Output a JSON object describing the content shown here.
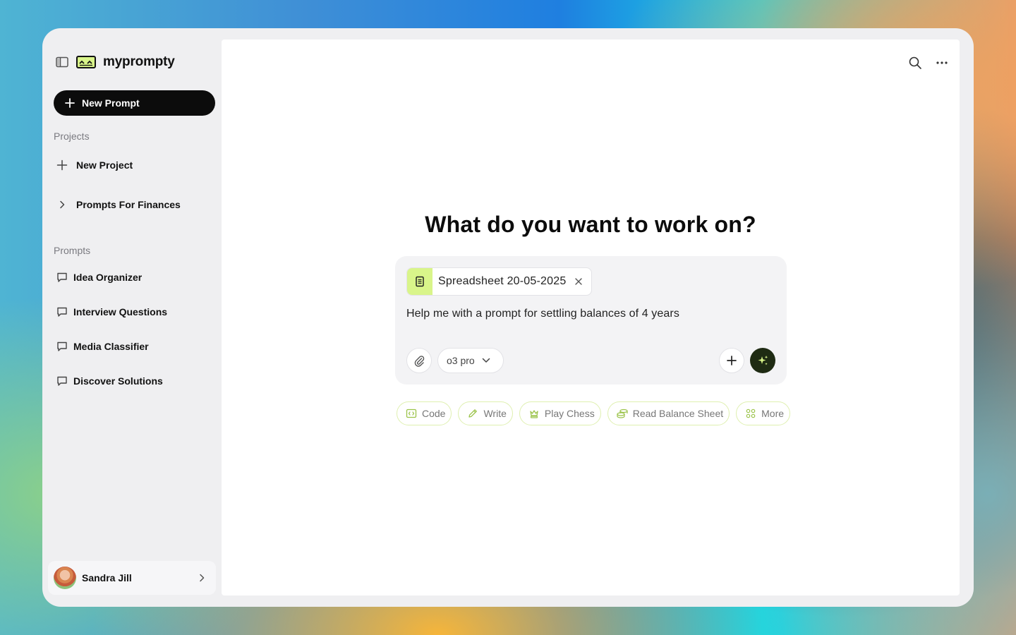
{
  "app": {
    "name": "myprompty"
  },
  "sidebar": {
    "new_prompt_label": "New Prompt",
    "projects_label": "Projects",
    "projects": [
      {
        "label": "New Project",
        "icon": "plus-icon"
      },
      {
        "label": "Prompts For Finances",
        "icon": "chevron-right-icon"
      }
    ],
    "prompts_label": "Prompts",
    "prompts": [
      {
        "label": "Idea Organizer",
        "icon": "chat-bubble-icon"
      },
      {
        "label": "Interview Questions",
        "icon": "chat-bubble-icon"
      },
      {
        "label": "Media Classifier",
        "icon": "chat-bubble-icon"
      },
      {
        "label": "Discover Solutions",
        "icon": "chat-bubble-icon"
      }
    ],
    "user": {
      "name": "Sandra Jill"
    }
  },
  "main": {
    "headline": "What do you want to work on?",
    "composer": {
      "attachment": "Spreadsheet 20-05-2025",
      "text": "Help me with a prompt for settling balances of 4 years",
      "model": "o3 pro"
    },
    "quick_actions": [
      {
        "label": "Code",
        "icon": "code-icon"
      },
      {
        "label": "Write",
        "icon": "pencil-icon"
      },
      {
        "label": "Play Chess",
        "icon": "chess-icon"
      },
      {
        "label": "Read Balance Sheet",
        "icon": "coins-icon"
      },
      {
        "label": "More",
        "icon": "grid-icon"
      }
    ]
  },
  "colors": {
    "accent": "#d9f58a",
    "dark_button": "#1f2b13",
    "primary_button": "#0c0c0c"
  }
}
